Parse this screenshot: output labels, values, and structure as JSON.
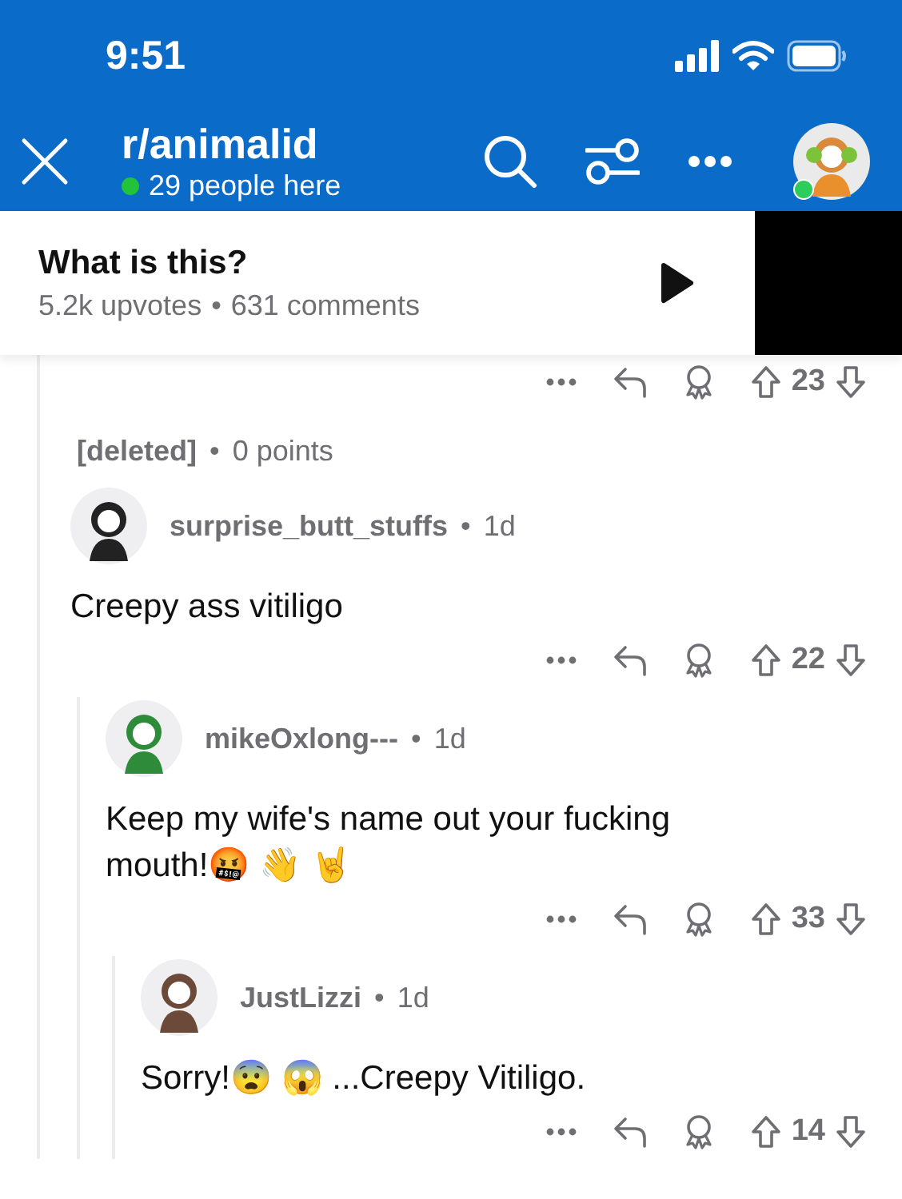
{
  "status_bar": {
    "time": "9:51"
  },
  "nav": {
    "title": "r/animalid",
    "online": "29 people here"
  },
  "post": {
    "title": "What is this?",
    "upvotes": "5.2k upvotes",
    "comments": "631 comments",
    "separator": "•"
  },
  "partial_actions": {
    "score": "23"
  },
  "comments": [
    {
      "kind": "deleted",
      "author": "[deleted]",
      "separator": "•",
      "meta": "0 points"
    },
    {
      "kind": "comment",
      "author": "surprise_butt_stuffs",
      "separator": "•",
      "age": "1d",
      "body": "Creepy ass vitiligo",
      "score": "22",
      "color": "#222222",
      "children": [
        {
          "kind": "comment",
          "author": "mikeOxlong---",
          "separator": "•",
          "age": "1d",
          "body": "Keep my wife's name out your fucking mouth!🤬 👋 🤘",
          "score": "33",
          "color": "#2e8b3a",
          "children": [
            {
              "kind": "comment",
              "author": "JustLizzi",
              "separator": "•",
              "age": "1d",
              "body": "Sorry!😨 😱  ...Creepy Vitiligo.",
              "score": "14",
              "color": "#6b4a3a"
            }
          ]
        }
      ]
    }
  ]
}
